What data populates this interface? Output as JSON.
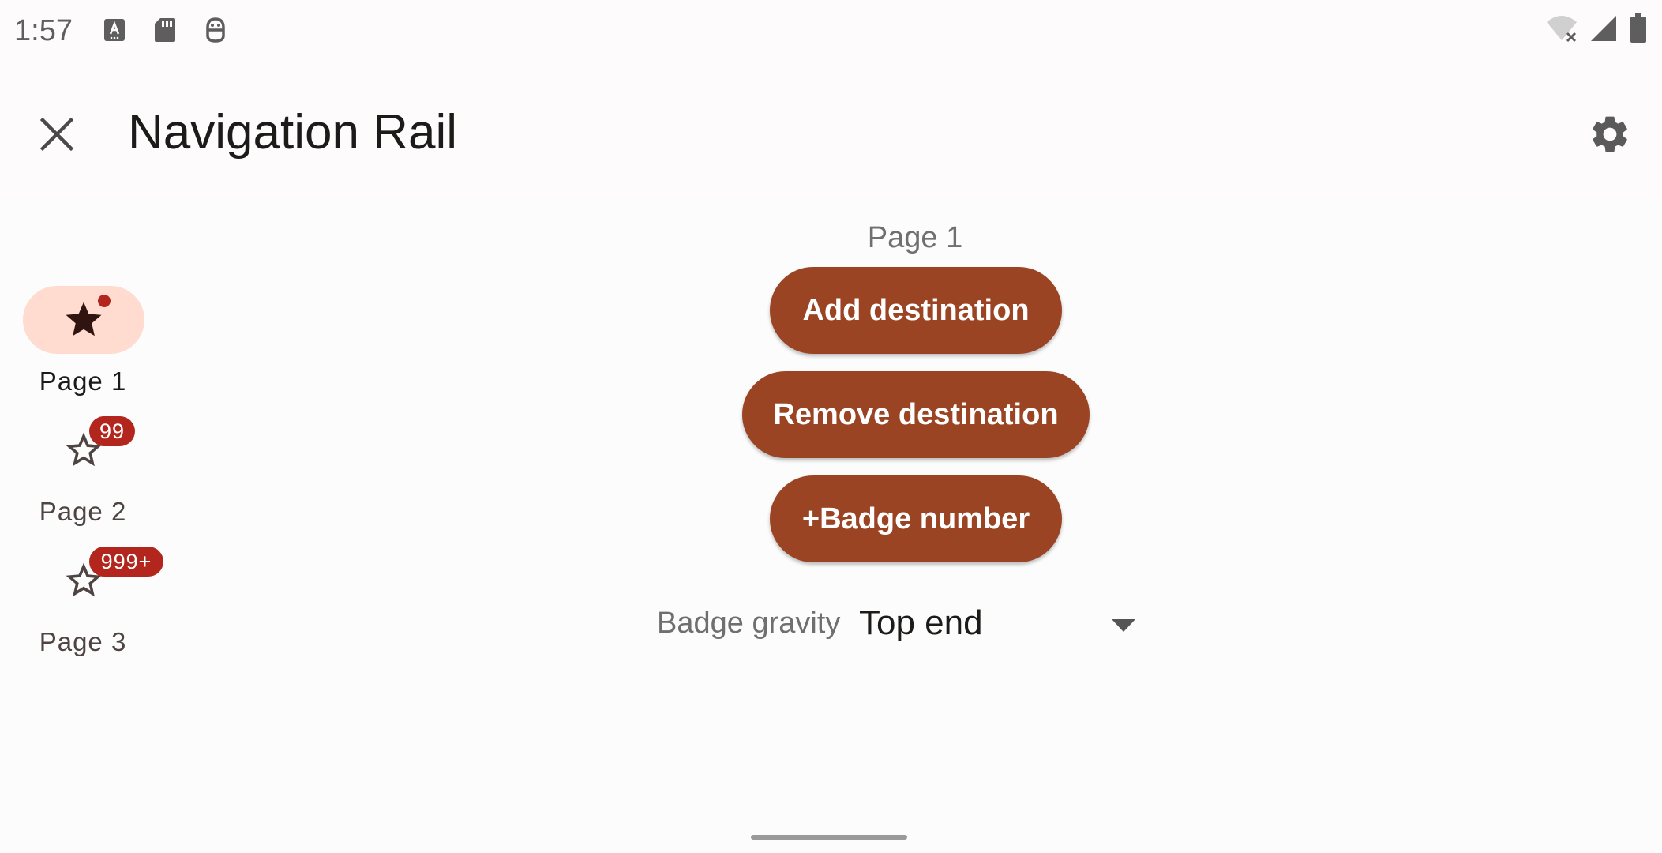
{
  "status_bar": {
    "time": "1:57",
    "left_icons": [
      "keyboard-a-icon",
      "sd-card-icon",
      "android-debug-icon"
    ],
    "right_icons": [
      "wifi-off-icon",
      "cell-signal-icon",
      "battery-icon"
    ]
  },
  "app_bar": {
    "title": "Navigation Rail",
    "close_icon": "close-icon",
    "settings_icon": "gear-icon"
  },
  "navigation_rail": {
    "items": [
      {
        "label": "Page 1",
        "icon": "star-filled-icon",
        "active": true,
        "badge": ""
      },
      {
        "label": "Page 2",
        "icon": "star-outline-icon",
        "active": false,
        "badge": "99"
      },
      {
        "label": "Page 3",
        "icon": "star-outline-icon",
        "active": false,
        "badge": "999+"
      }
    ]
  },
  "main": {
    "page_label": "Page 1",
    "buttons": {
      "add": "Add destination",
      "remove": "Remove destination",
      "badge": "+Badge number"
    },
    "gravity_label": "Badge gravity",
    "gravity_value": "Top end"
  },
  "colors": {
    "accent": "#9b4424",
    "active_indicator": "#ffdbd0",
    "badge": "#b3261e"
  }
}
